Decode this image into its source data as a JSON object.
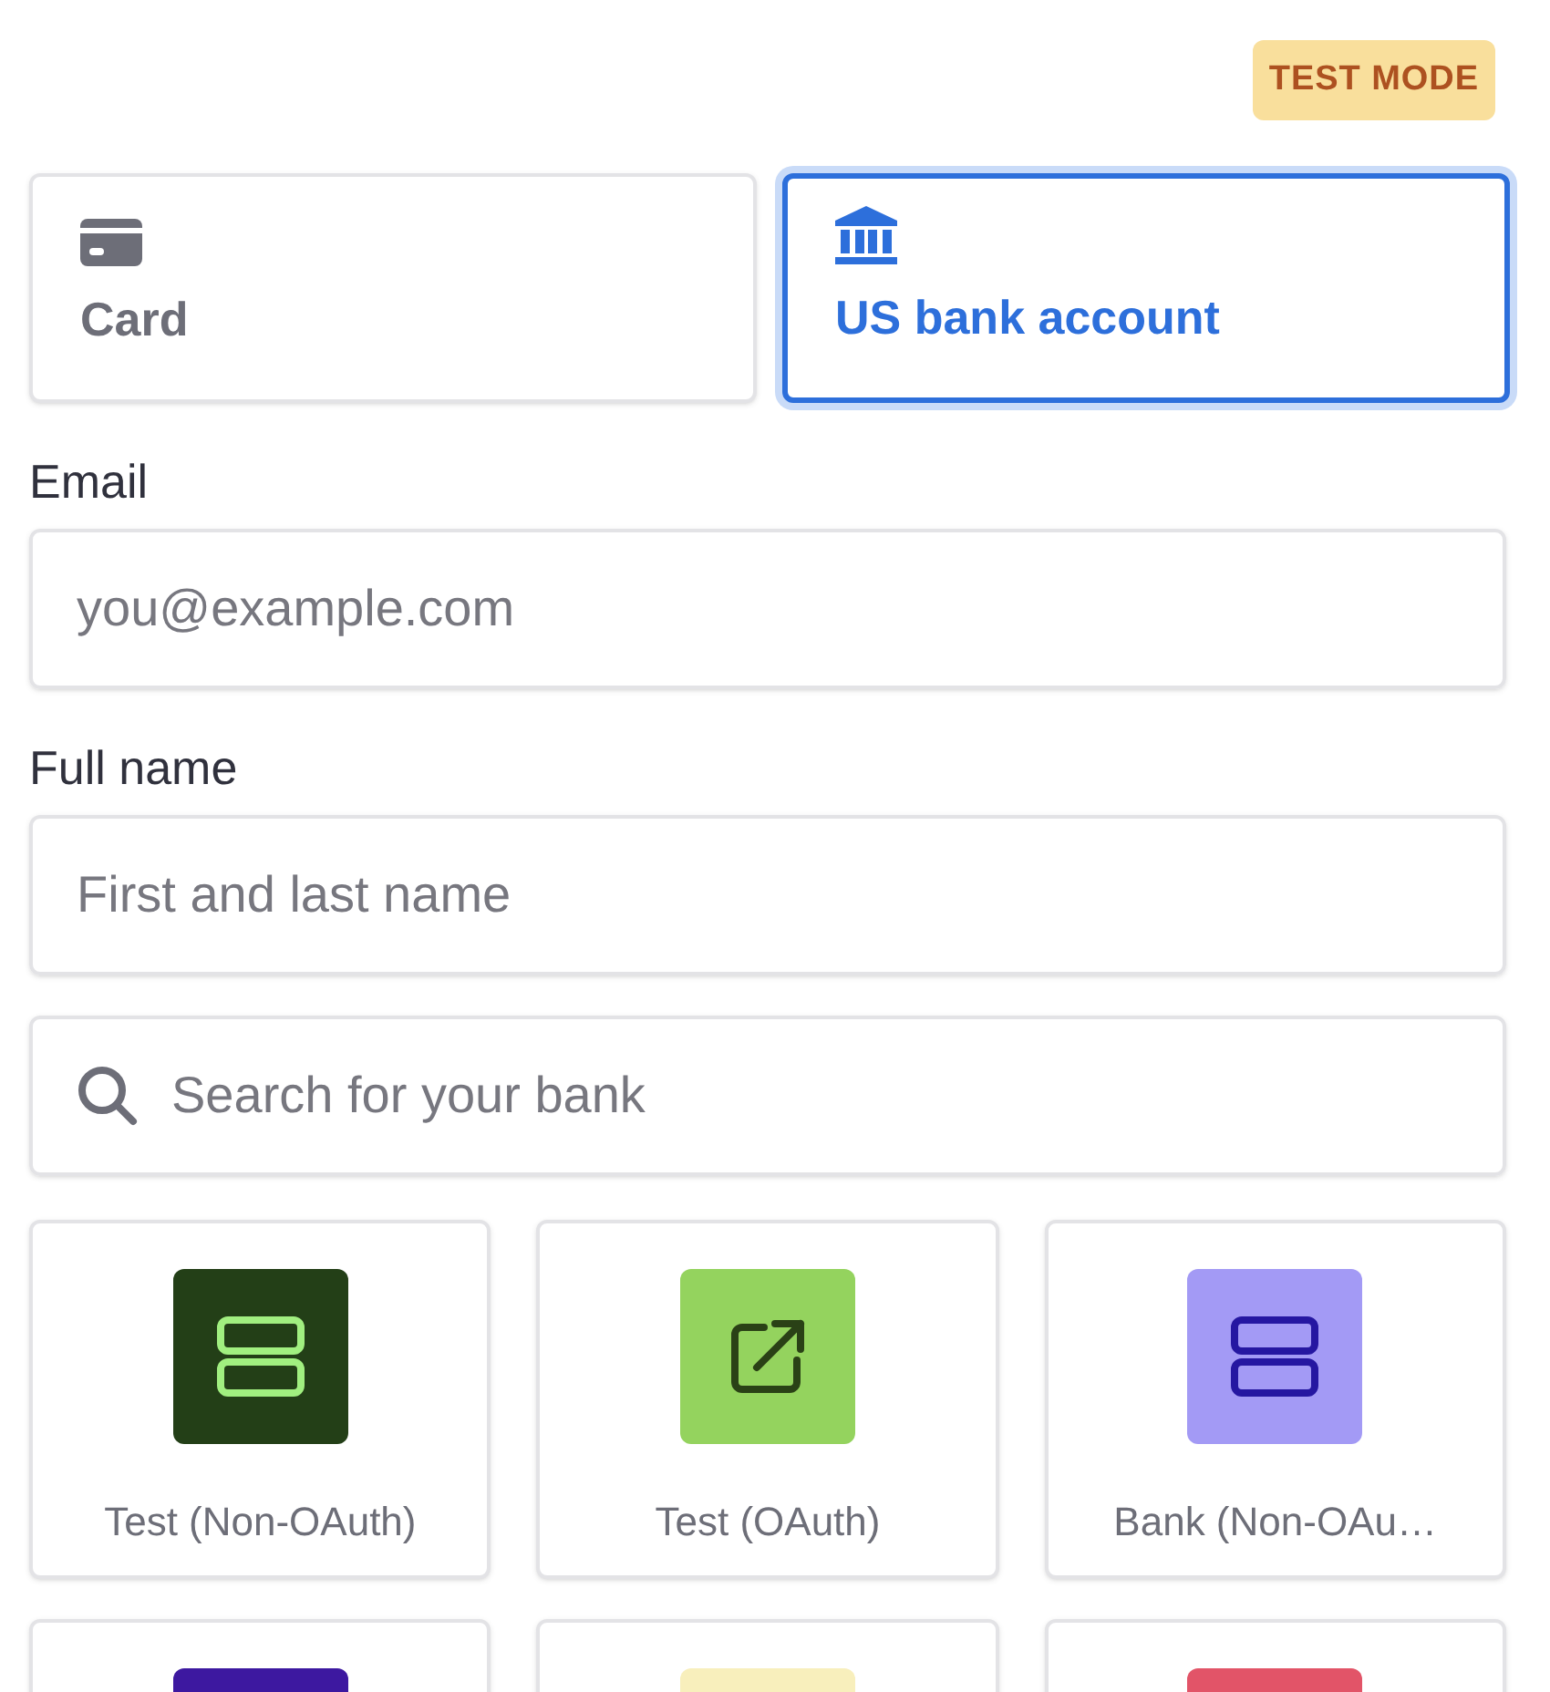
{
  "badge": "TEST MODE",
  "tabs": [
    {
      "label": "Card",
      "kind": "card",
      "selected": false
    },
    {
      "label": "US bank account",
      "kind": "bank",
      "selected": true
    }
  ],
  "fields": [
    {
      "label": "Email",
      "placeholder": "you@example.com"
    },
    {
      "label": "Full name",
      "placeholder": "First and last name"
    }
  ],
  "search": {
    "placeholder": "Search for your bank"
  },
  "banks": [
    {
      "name": "Test (Non-OAuth)",
      "kind": "stack",
      "color": "#233f17"
    },
    {
      "name": "Test (OAuth)",
      "kind": "external",
      "color": "#94d35e"
    },
    {
      "name": "Bank (Non-OAu…",
      "kind": "stack",
      "color": "#a39af5"
    },
    {
      "kind": "cut",
      "color": "#3d18a0"
    },
    {
      "kind": "cut",
      "color": "#f8efbc"
    },
    {
      "kind": "cut",
      "color": "#e25468"
    }
  ]
}
